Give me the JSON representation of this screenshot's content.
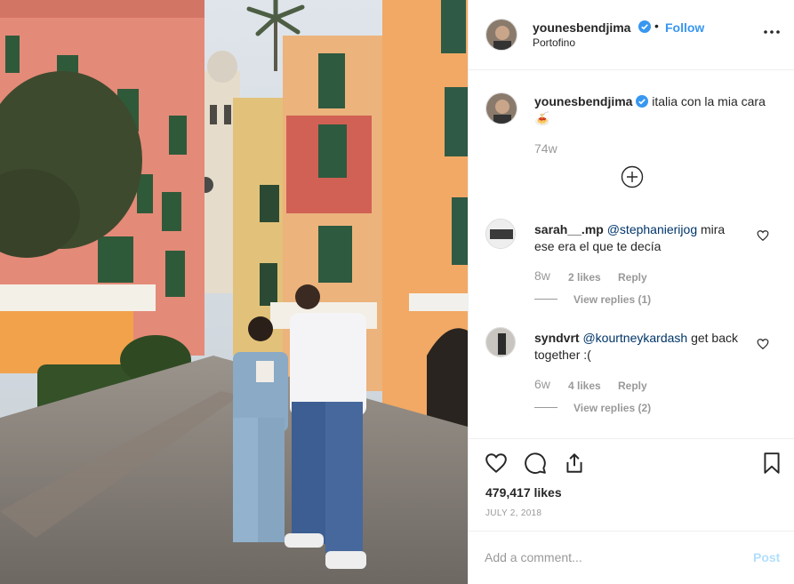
{
  "header": {
    "username": "younesbendjima",
    "verified_icon": "verified-badge-icon",
    "separator": "•",
    "follow_label": "Follow",
    "location": "Portofino",
    "more_icon": "more-options-icon"
  },
  "caption": {
    "username": "younesbendjima",
    "text": "italia con la mia cara",
    "emoji": "🍝",
    "age": "74w",
    "load_more_icon": "plus-circle-icon"
  },
  "comments": [
    {
      "username": "sarah__.mp",
      "mention": "@stephanierijog",
      "text": "mira ese era el que te decía",
      "age": "8w",
      "likes": "2 likes",
      "reply_label": "Reply",
      "view_replies": "View replies (1)"
    },
    {
      "username": "syndvrt",
      "mention": "@kourtneykardash",
      "text": "get back together :(",
      "age": "6w",
      "likes": "4 likes",
      "reply_label": "Reply",
      "view_replies": "View replies (2)"
    }
  ],
  "actions": {
    "icons": [
      "heart-icon",
      "comment-icon",
      "share-icon",
      "bookmark-icon"
    ],
    "likes": "479,417 likes",
    "date": "JULY 2, 2018"
  },
  "add_comment": {
    "placeholder": "Add a comment...",
    "post_label": "Post"
  },
  "colors": {
    "link_blue": "#3897f0",
    "mention_blue": "#003569",
    "muted_text": "#999999",
    "post_disabled": "#b2dffc"
  }
}
